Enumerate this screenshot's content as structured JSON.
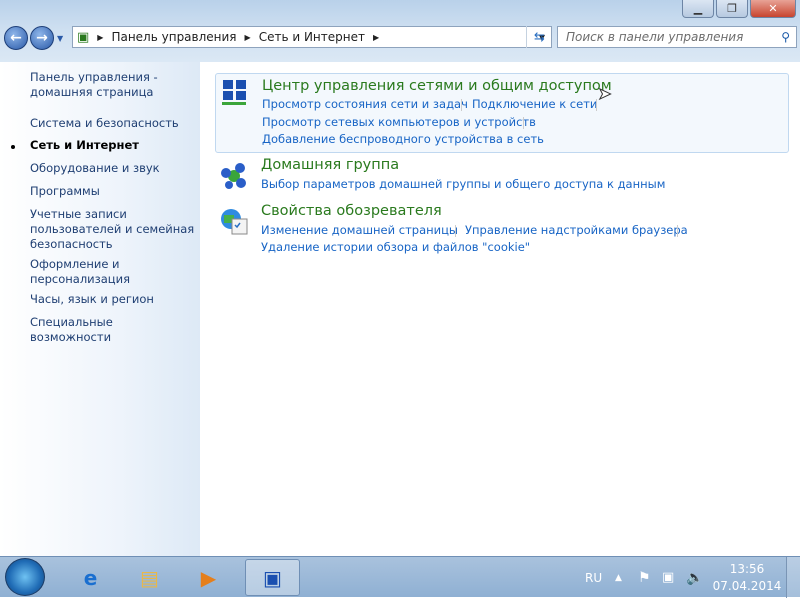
{
  "window": {
    "minimize_icon": "minimize-icon",
    "maximize_icon": "restore-icon",
    "close_icon": "close-icon"
  },
  "address": {
    "crumbs": [
      "Панель управления",
      "Сеть и Интернет"
    ]
  },
  "search": {
    "placeholder": "Поиск в панели управления"
  },
  "sidebar": {
    "items": [
      "Панель управления - домашняя страница",
      "Система и безопасность",
      "Сеть и Интернет",
      "Оборудование и звук",
      "Программы",
      "Учетные записи пользователей и семейная безопасность",
      "Оформление и персонализация",
      "Часы, язык и регион",
      "Специальные возможности"
    ],
    "current_index": 2
  },
  "groups": [
    {
      "title": "Центр управления сетями и общим доступом",
      "links": [
        "Просмотр состояния сети и задач",
        "Подключение к сети",
        "Просмотр сетевых компьютеров и устройств",
        "Добавление беспроводного устройства в сеть"
      ]
    },
    {
      "title": "Домашняя группа",
      "links": [
        "Выбор параметров домашней группы и общего доступа к данным"
      ]
    },
    {
      "title": "Свойства обозревателя",
      "links": [
        "Изменение домашней страницы",
        "Управление надстройками браузера",
        "Удаление истории обзора и файлов \"cookie\""
      ]
    }
  ],
  "taskbar": {
    "language": "RU",
    "time": "13:56",
    "date": "07.04.2014"
  }
}
